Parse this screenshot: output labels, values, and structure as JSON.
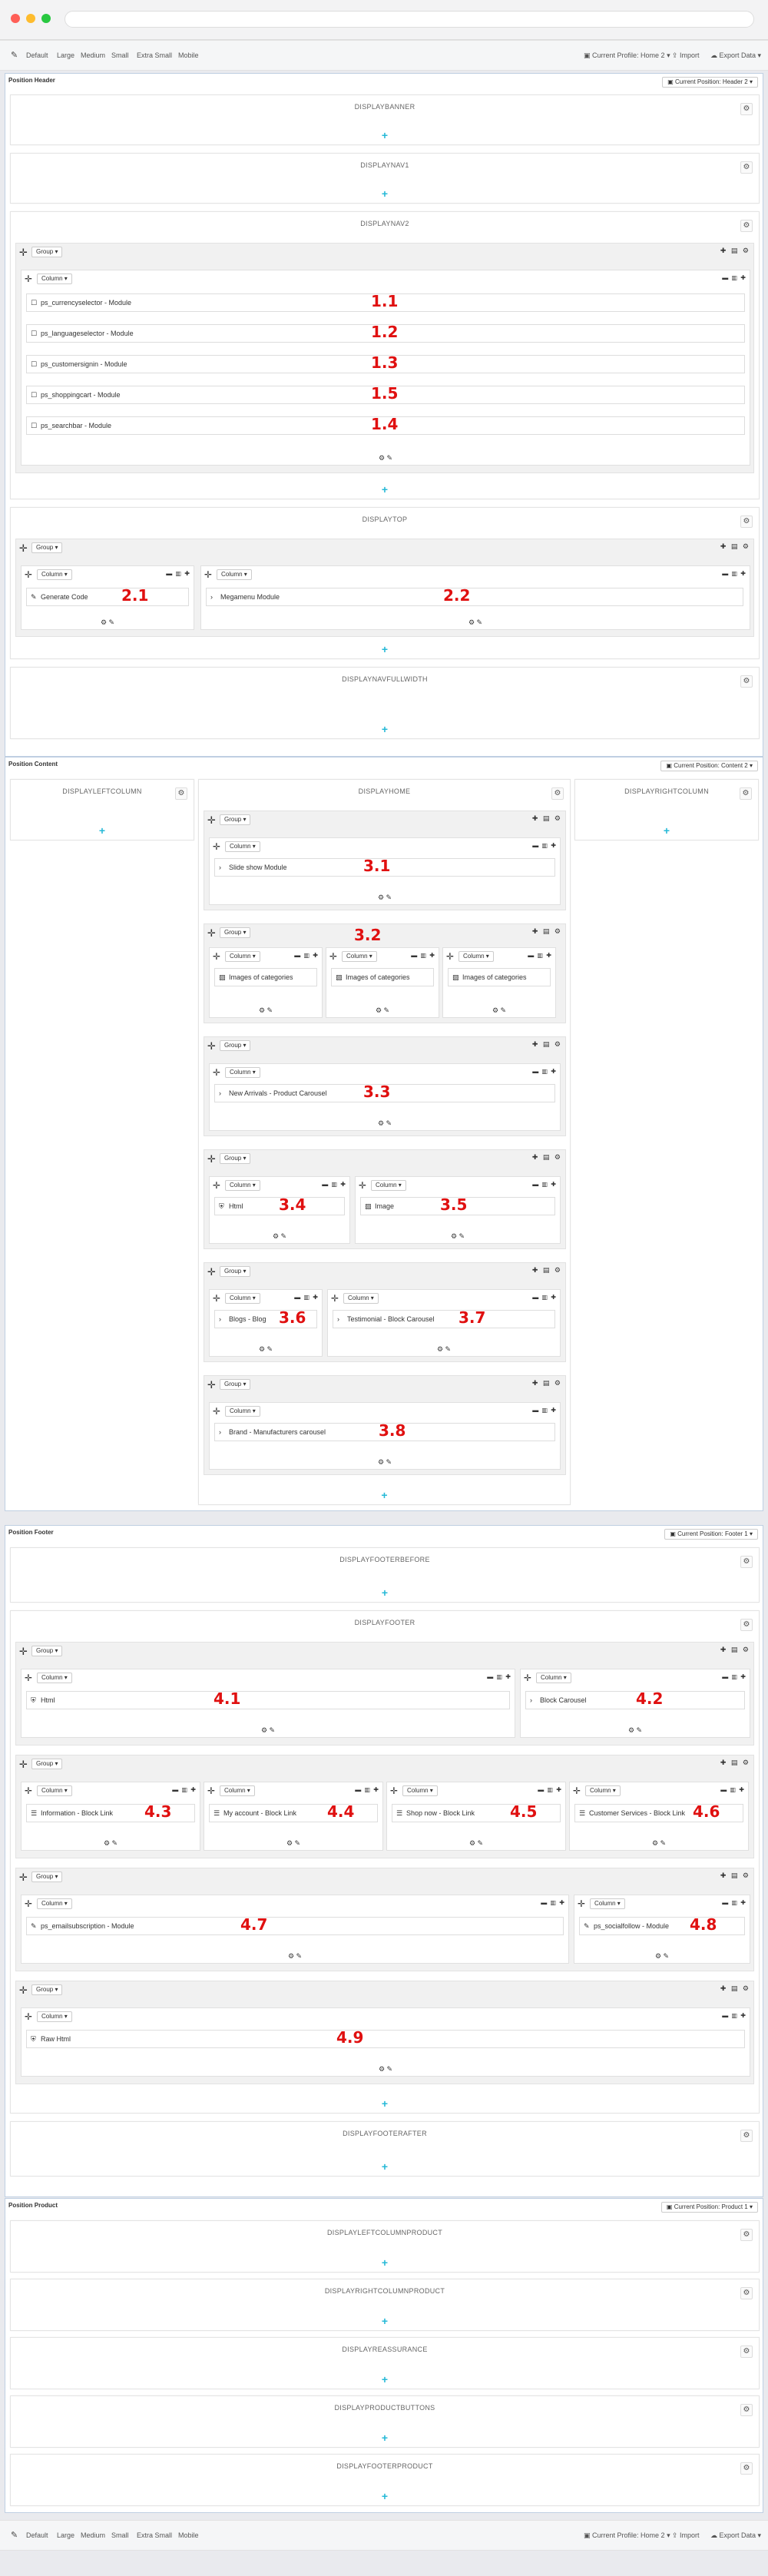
{
  "toolbar": {
    "devices": [
      "Default",
      "Large",
      "Medium",
      "Small",
      "Extra Small",
      "Mobile"
    ],
    "profile": "Current Profile: Home 2",
    "import": "Import",
    "export": "Export Data"
  },
  "header": {
    "title": "Position Header",
    "select": "Current Position: Header 2",
    "hooks": [
      "DISPLAYBANNER",
      "DISPLAYNAV1",
      "DISPLAYNAV2",
      "DISPLAYTOP",
      "DISPLAYNAVFULLWIDTH"
    ]
  },
  "content": {
    "title": "Position Content",
    "select": "Current Position: Content 2",
    "hooks": [
      "DISPLAYLEFTCOLUMN",
      "DISPLAYHOME",
      "DISPLAYRIGHTCOLUMN"
    ]
  },
  "footer": {
    "title": "Position Footer",
    "select": "Current Position: Footer 1",
    "hooks": [
      "DISPLAYFOOTERBEFORE",
      "DISPLAYFOOTER",
      "DISPLAYFOOTERAFTER"
    ]
  },
  "product": {
    "title": "Position Product",
    "select": "Current Position: Product 1",
    "hooks": [
      "DISPLAYLEFTCOLUMNPRODUCT",
      "DISPLAYRIGHTCOLUMNPRODUCT",
      "DISPLAYREASSURANCE",
      "DISPLAYPRODUCTBUTTONS",
      "DISPLAYFOOTERPRODUCT"
    ]
  },
  "labels": {
    "group": "Group",
    "column": "Column"
  },
  "modules": {
    "nav2": [
      "ps_currencyselector - Module",
      "ps_languageselector - Module",
      "ps_customersignin - Module",
      "ps_shoppingcart - Module",
      "ps_searchbar - Module"
    ],
    "top": [
      "Generate Code",
      "Megamenu Module"
    ],
    "home": [
      "Slide show Module",
      "Images of categories",
      "Images of categories",
      "Images of categories",
      "New Arrivals - Product Carousel",
      "Html",
      "Image",
      "Blogs - Blog",
      "Testimonial - Block Carousel",
      "Brand - Manufacturers carousel"
    ],
    "footer": [
      "Html",
      "Block Carousel",
      "Information - Block Link",
      "My account - Block Link",
      "Shop now - Block Link",
      "Customer Services - Block Link",
      "ps_emailsubscription - Module",
      "ps_socialfollow - Module",
      "Raw Html"
    ]
  },
  "numbers": {
    "nav2": [
      "1.1",
      "1.2",
      "1.3",
      "1.5",
      "1.4"
    ],
    "top": [
      "2.1",
      "2.2"
    ],
    "home": [
      "3.1",
      "3.2",
      "3.3",
      "3.4",
      "3.5",
      "3.6",
      "3.7",
      "3.8"
    ],
    "footer": [
      "4.1",
      "4.2",
      "4.3",
      "4.4",
      "4.5",
      "4.6",
      "4.7",
      "4.8",
      "4.9"
    ]
  },
  "colors": {
    "accent": "#25b9d7",
    "annotation": "#e01010"
  }
}
